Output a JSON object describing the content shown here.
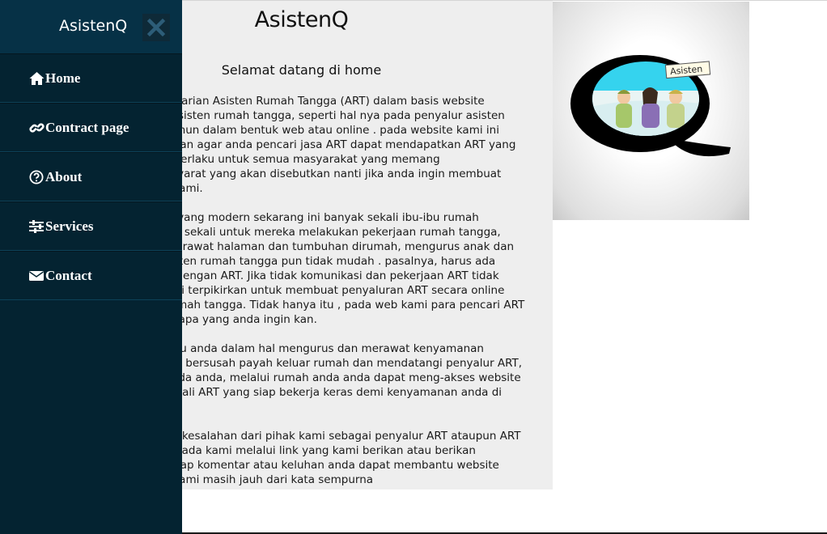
{
  "sidebar": {
    "brand": "AsistenQ",
    "items": [
      {
        "label": "Home",
        "icon": "home-icon"
      },
      {
        "label": "Contract page",
        "icon": "link-icon"
      },
      {
        "label": "About",
        "icon": "question-circle-icon"
      },
      {
        "label": "Services",
        "icon": "sliders-icon"
      },
      {
        "label": "Contact",
        "icon": "envelope-icon"
      }
    ]
  },
  "main": {
    "title": "AsistenQ",
    "subtitle": "Selamat datang di home",
    "paragraphs": [
      [
        "rkan pencarian Asisten Rumah Tangga (ART) dalam basis website",
        "ncarian asisten rumah tangga, seperti hal nya pada penyalur asisten",
        "mnya namun dalam bentuk web atau online . pada website kami ini",
        " atau arahan agar anda pencari jasa ART dapat mendapatkan ART yang",
        "bsite ini berlaku untuk semua masyarakat yang memang",
        "dengan syarat yang akan disebutkan nanti jika anda ingin membuat",
        " website kami."
      ],
      [
        "a zaman yang modern sekarang ini banyak sekali ibu-ibu rumah",
        "ngga sulit sekali untuk mereka melakukan pekerjaan rumah tangga,",
        "umah, merawat halaman dan tumbuhan dirumah, mengurus anak dan",
        "ncari asisten rumah tangga pun tidak mudah . pasalnya, harus ada",
        "k rumah dengan ART. Jika tidak komunikasi dan pekerjaan ART tidak",
        "ngga kami terpikirkan untuk membuat penyaluran ART secara online",
        "erjaan rumah tangga. Tidak hanya itu , pada web kami para pencari ART",
        "T seperti apa yang anda ingin kan."
      ],
      [
        "membantu anda dalam hal mengurus dan merawat kenyamanan",
        "mpa anda bersusah payah keluar rumah dan mendatangi penyalur ART,",
        "dahan pada anda, melalui rumah anda anda dapat meng-akses website",
        "anyak sekali ART yang siap bekerja keras demi kenyamanan anda di",
        "a."
      ],
      [
        "alah atau kesalahan dari pihak kami sebagai penyalur ART ataupun ART",
        "an anda pada kami melalui link yang kami berikan atau berikan",
        "kami. setiap komentar atau keluhan anda dapat membantu website",
        " website kami masih jauh dari kata sempurna"
      ]
    ]
  },
  "logo": {
    "banner": "Asisten",
    "letter": "Q"
  },
  "colors": {
    "sidebar_bg": "#042331",
    "sidebar_header_bg": "#063146",
    "close_icon": "#2d5d78",
    "main_bg": "#eeeeee",
    "logo_sky": "#35d3ee"
  }
}
